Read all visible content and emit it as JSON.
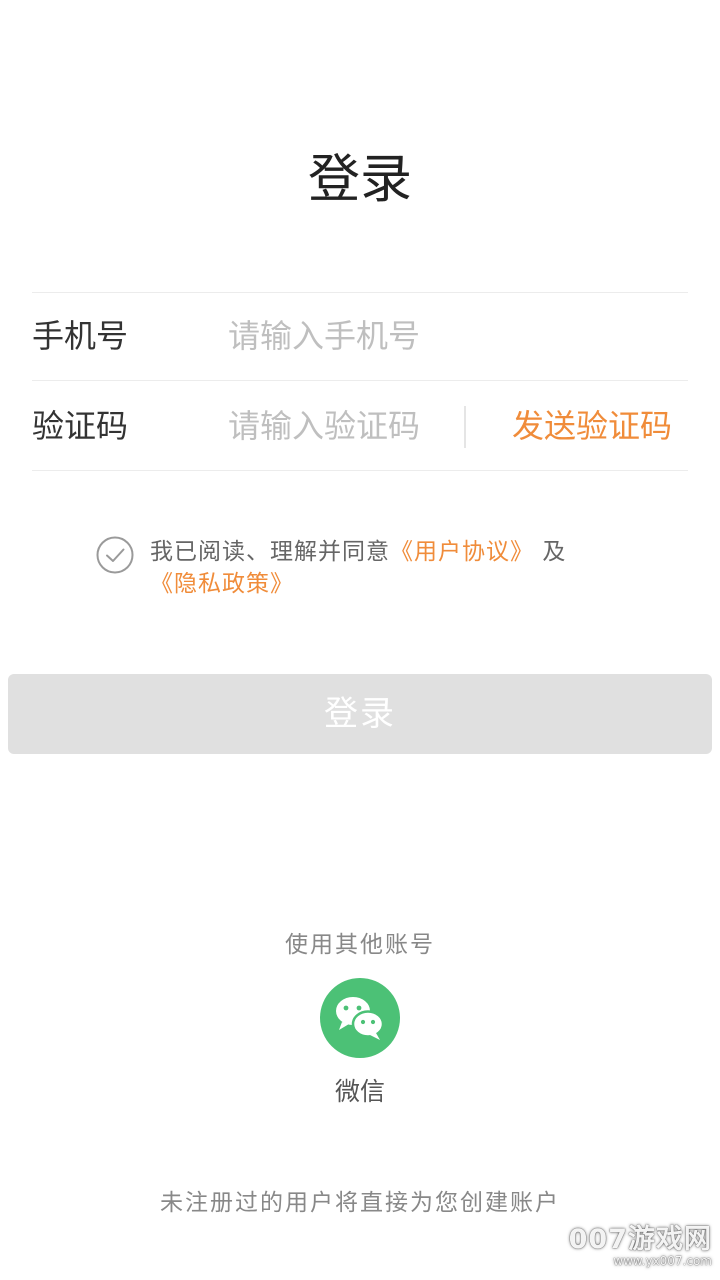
{
  "header": {
    "title": "登录"
  },
  "form": {
    "phone": {
      "label": "手机号",
      "placeholder": "请输入手机号",
      "value": ""
    },
    "code": {
      "label": "验证码",
      "placeholder": "请输入验证码",
      "value": "",
      "send_label": "发送验证码"
    }
  },
  "agreement": {
    "checked": true,
    "text_prefix": "我已阅读、理解并同意",
    "user_agreement": "《用户协议》",
    "conjunction": "及",
    "privacy_policy": "《隐私政策》"
  },
  "login_button": {
    "label": "登录"
  },
  "other_login": {
    "label": "使用其他账号",
    "wechat_label": "微信",
    "wechat_icon": "wechat-icon"
  },
  "footer": {
    "note": "未注册过的用户将直接为您创建账户"
  },
  "watermark": {
    "main": "007游戏网",
    "url": "www.yx007.com"
  },
  "colors": {
    "accent": "#f08c3a",
    "button_disabled": "#e0e0e0",
    "wechat_green": "#4cc176"
  }
}
